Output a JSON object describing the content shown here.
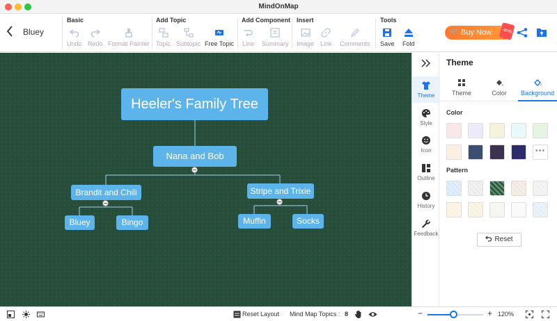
{
  "window": {
    "title": "MindOnMap"
  },
  "toolbar": {
    "filename": "Bluey",
    "groups": {
      "basic": "Basic",
      "add_topic": "Add Topic",
      "add_component": "Add Component",
      "insert": "Insert",
      "tools": "Tools"
    },
    "buttons": {
      "undo": "Undo",
      "redo": "Redo",
      "format_painter": "Format Painter",
      "topic": "Topic",
      "subtopic": "Subtopic",
      "free_topic": "Free Topic",
      "line": "Line",
      "summary": "Summary",
      "image": "Image",
      "link": "Link",
      "comments": "Comments",
      "save": "Save",
      "fold": "Fold"
    },
    "buy_now": {
      "label": "Buy Now",
      "badge": "-90%"
    }
  },
  "mindmap": {
    "root": "Heeler's Family Tree",
    "level1": "Nana and Bob",
    "level2": [
      "Brandit and Chili",
      "Stripe and Trixie"
    ],
    "level3": [
      "Bluey",
      "Bingo",
      "Muffin",
      "Socks"
    ],
    "colors": {
      "background": "#274d3b",
      "node": "#5cb4ea",
      "connector": "#9fd4f3"
    }
  },
  "side_tabs": [
    "Theme",
    "Style",
    "Icon",
    "Outline",
    "History",
    "Feedback"
  ],
  "panel": {
    "title": "Theme",
    "tabs": [
      "Theme",
      "Color",
      "Background"
    ],
    "active_tab": "Background",
    "color_label": "Color",
    "pattern_label": "Pattern",
    "reset_label": "Reset",
    "color_swatches": [
      "#f9e8ea",
      "#ecebfb",
      "#f6f3dc",
      "#e9f8f9",
      "#e6f4e2",
      "#fcf0e2",
      "#3b4f6e",
      "#3c3350",
      "#2c2c6c",
      "more"
    ],
    "pattern_swatches": [
      "#d7e9fb",
      "#ececec",
      "#2a5a3c",
      "#f2e8de",
      "#f0f0f0",
      "#fbf2e0",
      "#f7f1df",
      "#f5f5f0",
      "#fafafa",
      "#e6eef8"
    ]
  },
  "statusbar": {
    "reset_layout": "Reset Layout",
    "topics_label": "Mind Map Topics :",
    "topics_count": "8",
    "zoom": "120%",
    "zoom_level": 0.47
  }
}
